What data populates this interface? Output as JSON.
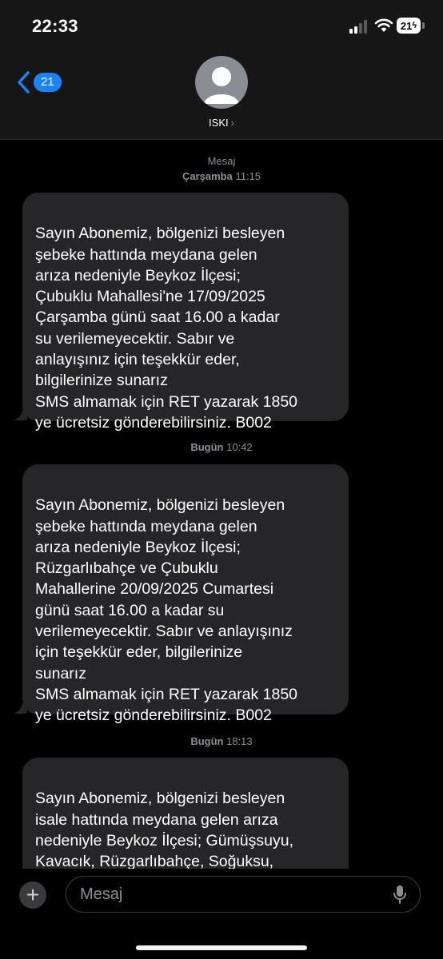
{
  "status_bar": {
    "time": "22:33",
    "battery": "21"
  },
  "header": {
    "back_count": "21",
    "contact_name": "ISKI",
    "chevron": "›"
  },
  "messages": [
    {
      "stamp_title": "Mesaj",
      "stamp_day": "Çarşamba",
      "stamp_time": "11:15",
      "text": "Sayın Abonemiz, bölgenizi besleyen\nşebeke hattında meydana gelen\narıza nedeniyle Beykoz İlçesi;\nÇubuklu Mahallesi'ne 17/09/2025\nÇarşamba günü saat 16.00 a kadar\nsu verilemeyecektir. Sabır ve\nanlayışınız için teşekkür eder,\nbilgilerinize sunarız\nSMS almamak için RET yazarak 1850\nye ücretsiz gönderebilirsiniz. B002"
    },
    {
      "stamp_day": "Bugün",
      "stamp_time": "10:42",
      "text": "Sayın Abonemiz, bölgenizi besleyen\nşebeke hattında meydana gelen\narıza nedeniyle Beykoz İlçesi;\nRüzgarlıbahçe ve Çubuklu\nMahallerine 20/09/2025 Cumartesi\ngünü saat 16.00 a kadar su\nverilemeyecektir. Sabır ve anlayışınız\niçin teşekkür eder, bilgilerinize\nsunarız\nSMS almamak için RET yazarak 1850\nye ücretsiz gönderebilirsiniz. B002"
    },
    {
      "stamp_day": "Bugün",
      "stamp_time": "18:13",
      "text": "Sayın Abonemiz, bölgenizi besleyen\nisale hattında meydana gelen arıza\nnedeniyle Beykoz İlçesi; Gümüşsuyu,\nKavacık, Rüzgarlıbahçe, Soğuksu,\nÇubuklu, Çiğdem ve İncirköy"
    }
  ],
  "composer": {
    "placeholder": "Mesaj",
    "plus": "+"
  },
  "colors": {
    "accent": "#1a83f5",
    "bubble": "#262628",
    "background": "#000000",
    "header": "#161616"
  }
}
